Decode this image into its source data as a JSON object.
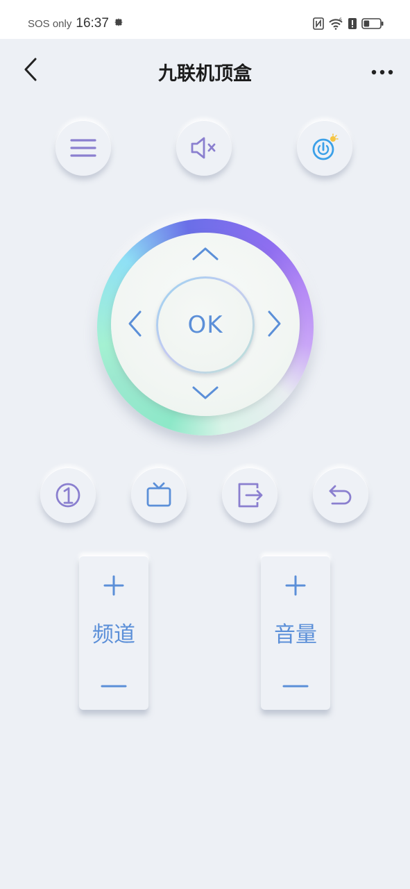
{
  "status_bar": {
    "carrier": "SOS only",
    "time": "16:37",
    "battery_level": 0.35,
    "icons": [
      "gear-icon",
      "nfc-icon",
      "wifi-icon",
      "alert-icon",
      "battery-icon"
    ]
  },
  "header": {
    "title": "九联机顶盒",
    "back_icon": "chevron-left-icon",
    "more_icon": "more-horizontal-icon"
  },
  "top_controls": [
    {
      "name": "menu",
      "icon": "menu-icon"
    },
    {
      "name": "mute",
      "icon": "mute-icon"
    },
    {
      "name": "power",
      "icon": "power-icon"
    }
  ],
  "dpad": {
    "ok_label": "OK",
    "icons": [
      "arrow-up-icon",
      "arrow-down-icon",
      "arrow-left-icon",
      "arrow-right-icon"
    ]
  },
  "function_row": [
    {
      "name": "number-one",
      "icon": "number-one-icon",
      "glyph": "①"
    },
    {
      "name": "tv",
      "icon": "tv-icon"
    },
    {
      "name": "input-source",
      "icon": "input-source-icon"
    },
    {
      "name": "return",
      "icon": "return-icon"
    }
  ],
  "rockers": {
    "channel": {
      "plus": "+",
      "label": "频道",
      "minus": "—"
    },
    "volume": {
      "plus": "+",
      "label": "音量",
      "minus": "—"
    }
  },
  "colors": {
    "accent_blue": "#5b8fd8",
    "icon_purple": "#8a7fcf",
    "background": "#edf0f5",
    "power_blue": "#3ba0e8",
    "bulb_yellow": "#f5c542"
  }
}
